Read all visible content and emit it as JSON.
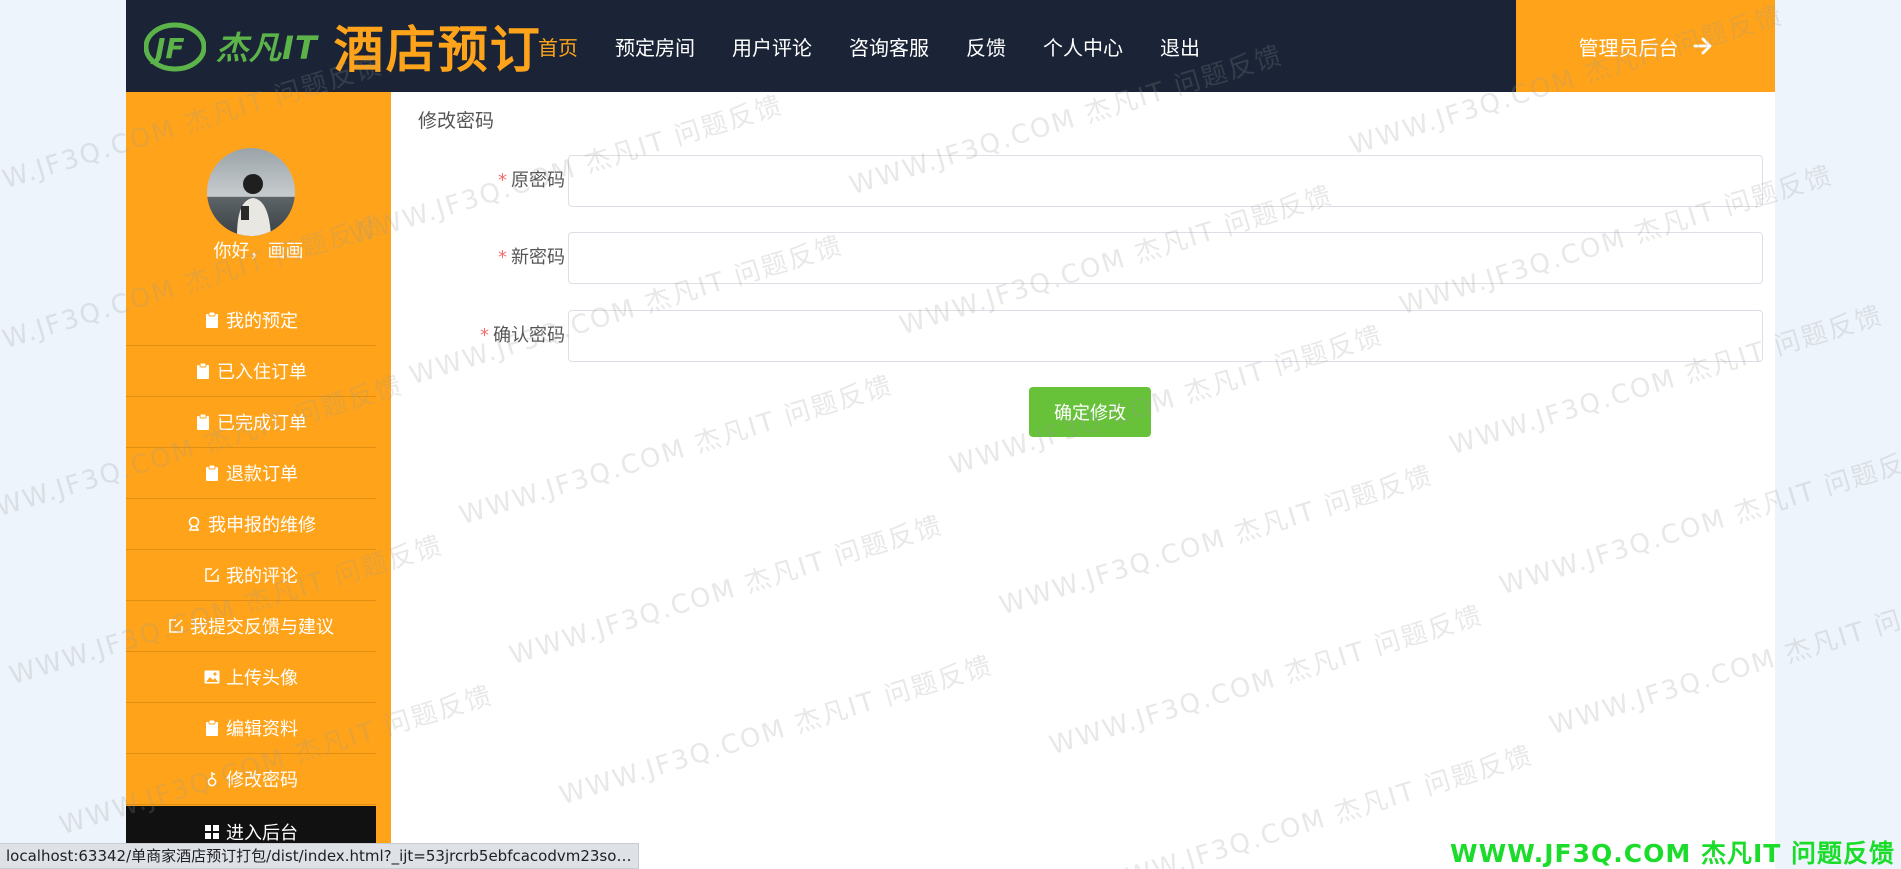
{
  "header": {
    "logo_small": "杰凡IT",
    "logo_title": "酒店预订",
    "nav": [
      {
        "label": "首页",
        "active": true
      },
      {
        "label": "预定房间",
        "active": false
      },
      {
        "label": "用户评论",
        "active": false
      },
      {
        "label": "咨询客服",
        "active": false
      },
      {
        "label": "反馈",
        "active": false
      },
      {
        "label": "个人中心",
        "active": false
      },
      {
        "label": "退出",
        "active": false
      }
    ],
    "admin_label": "管理员后台"
  },
  "sidebar": {
    "greeting": "你好，画画",
    "items": [
      {
        "label": "我的预定",
        "icon": "clipboard-icon"
      },
      {
        "label": "已入住订单",
        "icon": "clipboard-icon"
      },
      {
        "label": "已完成订单",
        "icon": "clipboard-icon"
      },
      {
        "label": "退款订单",
        "icon": "clipboard-icon"
      },
      {
        "label": "我申报的维修",
        "icon": "wrench-icon"
      },
      {
        "label": "我的评论",
        "icon": "edit-icon"
      },
      {
        "label": "我提交反馈与建议",
        "icon": "edit-icon"
      },
      {
        "label": "上传头像",
        "icon": "image-icon"
      },
      {
        "label": "编辑资料",
        "icon": "clipboard-icon"
      },
      {
        "label": "修改密码",
        "icon": "key-icon"
      }
    ],
    "backend_label": "进入后台"
  },
  "main": {
    "title": "修改密码",
    "fields": [
      {
        "label": "原密码",
        "value": "",
        "placeholder": ""
      },
      {
        "label": "新密码",
        "value": "",
        "placeholder": ""
      },
      {
        "label": "确认密码",
        "value": "",
        "placeholder": ""
      }
    ],
    "submit_label": "确定修改"
  },
  "statusbar": {
    "url": "localhost:63342/单商家酒店预订打包/dist/index.html?_ijt=53jrcrb5ebfcacodvm23somp..."
  },
  "watermark": {
    "text": "WWW.JF3Q.COM 杰凡IT 问题反馈",
    "corner_text": "WWW.JF3Q.COM 杰凡IT 问题反馈"
  },
  "colors": {
    "header_bg": "#1a2436",
    "accent_orange": "#ffa41a",
    "button_green": "#67c23a",
    "required_red": "#f56c6c"
  }
}
